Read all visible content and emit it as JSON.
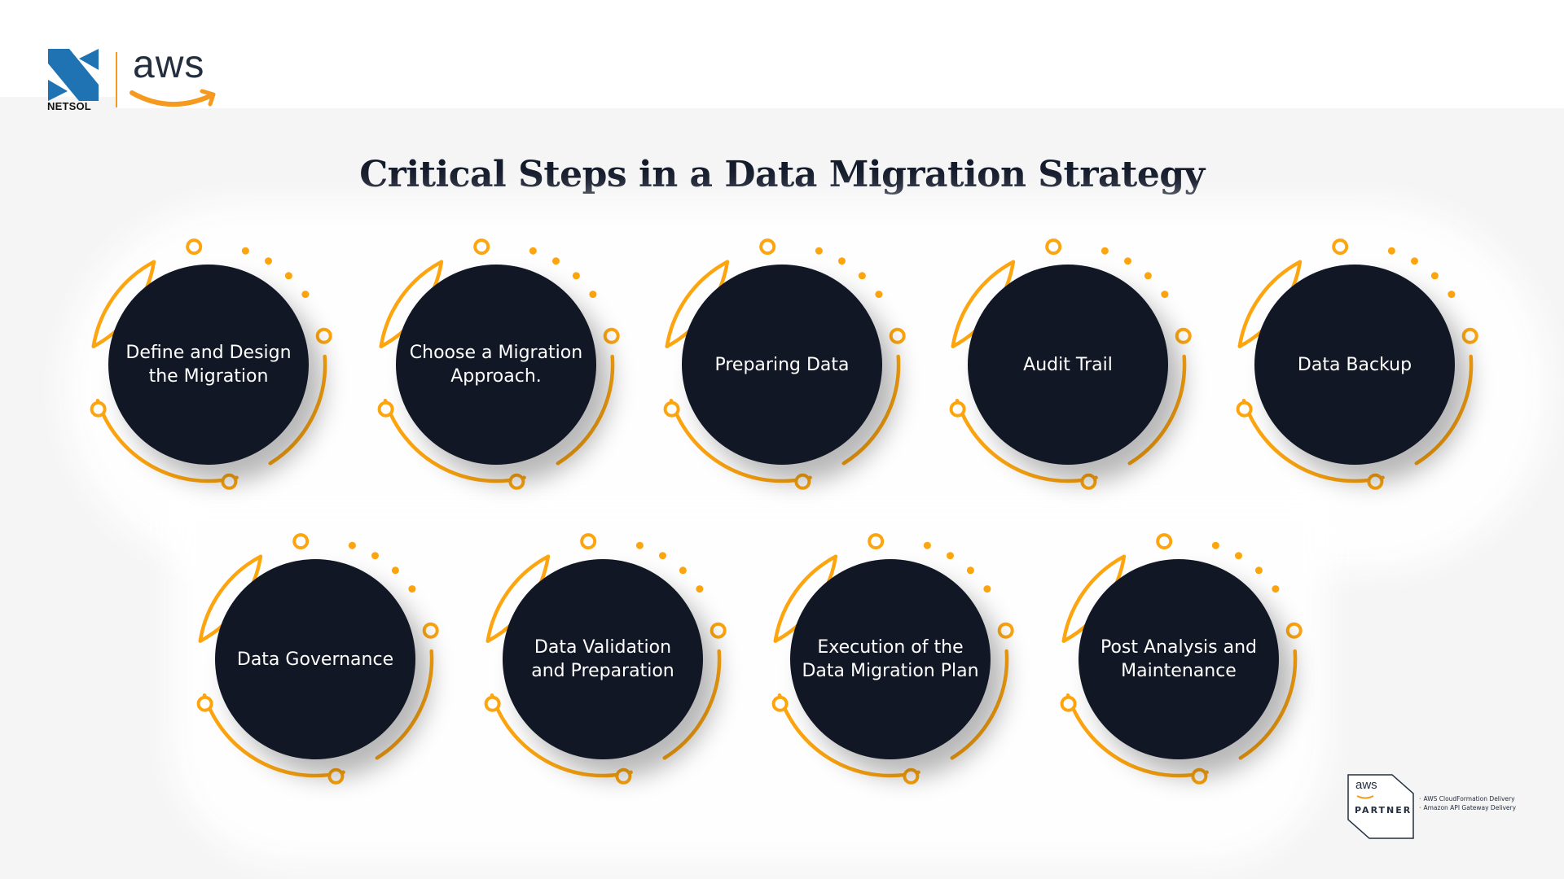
{
  "header": {
    "brand_primary": "NETSOL",
    "brand_primary_icon": "netsol-logo-icon",
    "brand_secondary": "aws",
    "brand_secondary_icon": "aws-smile-icon"
  },
  "title": "Critical Steps in a Data Migration Strategy",
  "colors": {
    "accent": "#fda50f",
    "disc": "#111725",
    "title": "#141b2b",
    "background": "#f5f5f5",
    "netsol_blue": "#1f73b3"
  },
  "steps": [
    {
      "label": "Define and Design\nthe Migration"
    },
    {
      "label": "Choose a Migration\nApproach."
    },
    {
      "label": "Preparing Data"
    },
    {
      "label": "Audit Trail"
    },
    {
      "label": "Data Backup"
    },
    {
      "label": "Data Governance"
    },
    {
      "label": "Data Validation\nand Preparation"
    },
    {
      "label": "Execution of the\nData Migration Plan"
    },
    {
      "label": "Post Analysis and\nMaintenance"
    }
  ],
  "partner_badge": {
    "logo": "aws",
    "label": "PARTNER",
    "competencies": [
      "AWS CloudFormation Delivery",
      "Amazon API Gateway Delivery"
    ]
  }
}
